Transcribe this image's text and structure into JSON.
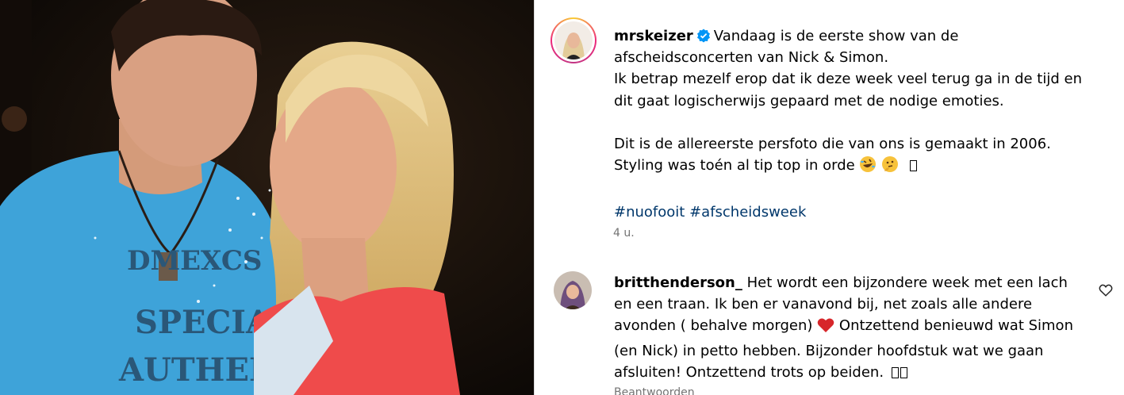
{
  "post": {
    "username": "mrskeizer",
    "verified": true,
    "line1": "Vandaag is de eerste show van de afscheidsconcerten van Nick & Simon.",
    "line2": "Ik betrap mezelf erop dat ik deze week veel terug ga in de tijd en dit gaat logischerwijs gepaard met de nodige emoties.",
    "line3": "Dit is de allereerste persfoto die van ons is gemaakt in 2006.",
    "line4": "Styling was toén al tip top in orde",
    "hashtags": [
      "#nuofooit",
      "#afscheidsweek"
    ],
    "time": "4 u."
  },
  "comment": {
    "username": "britthenderson_",
    "text_before_heart": "Het wordt een bijzondere week met een lach en een traan. Ik ben er vanavond bij, net zoals alle andere avonden ( behalve morgen)",
    "text_after_heart": "Ontzettend benieuwd wat Simon (en Nick) in petto hebben. Bijzonder hoofdstuk wat we gaan afsluiten! Ontzettend trots op beiden.",
    "next": "Beantwoorden"
  },
  "icons": {
    "verified": "verified-badge-icon",
    "like": "heart-outline-icon",
    "emoji_heart": "red-heart-emoji",
    "emoji_laugh": "rolling-laughing-emoji",
    "emoji_think": "thinking-emoji"
  },
  "colors": {
    "hashtag": "#00376b",
    "verified": "#0095f6",
    "meta": "#737373",
    "divider": "#dbdbdb"
  }
}
